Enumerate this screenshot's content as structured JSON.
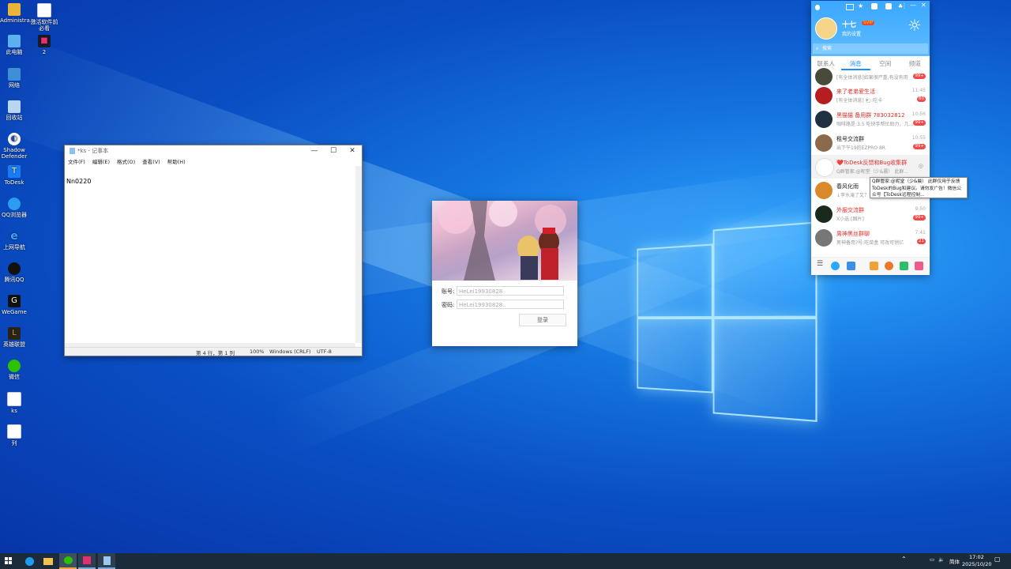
{
  "desktop": {
    "icons": [
      {
        "label": "Administra...",
        "icon": "user-folder-icon"
      },
      {
        "label": "激活软件前必看",
        "icon": "text-file-icon"
      },
      {
        "label": "此电脑",
        "icon": "computer-icon"
      },
      {
        "label": "2",
        "icon": "app-icon"
      },
      {
        "label": "网络",
        "icon": "network-icon"
      },
      {
        "label": "回收站",
        "icon": "recycle-bin-icon"
      },
      {
        "label": "Shadow Defender",
        "icon": "shadow-defender-icon"
      },
      {
        "label": "ToDesk",
        "icon": "todesk-icon"
      },
      {
        "label": "QQ浏览器",
        "icon": "qq-browser-icon"
      },
      {
        "label": "上网导航",
        "icon": "ie-icon"
      },
      {
        "label": "腾讯QQ",
        "icon": "qq-icon"
      },
      {
        "label": "WeGame",
        "icon": "wegame-icon"
      },
      {
        "label": "英雄联盟",
        "icon": "lol-icon"
      },
      {
        "label": "微信",
        "icon": "wechat-icon"
      },
      {
        "label": "ks",
        "icon": "text-file-icon"
      },
      {
        "label": "列",
        "icon": "text-file-icon"
      }
    ]
  },
  "notepad": {
    "title": "*ks - 记事本",
    "menu": [
      "文件(F)",
      "编辑(E)",
      "格式(O)",
      "查看(V)",
      "帮助(H)"
    ],
    "content": "Nn0220",
    "status": {
      "position": "第 4 行，第 1 列",
      "zoom": "100%",
      "line_ending": "Windows (CRLF)",
      "encoding": "UTF-8"
    }
  },
  "login": {
    "account_label": "账号:",
    "account_value": "HeLei19930828",
    "password_label": "密码:",
    "password_value": "HeLei19930828..",
    "login_button": "登录"
  },
  "qq": {
    "nickname": "十七",
    "vip": "SVIP",
    "status": "我的设置",
    "search_placeholder": "搜索",
    "tabs": [
      "联系人",
      "消息",
      "空间",
      "频道"
    ],
    "active_tab": "消息",
    "conversations": [
      {
        "name": "",
        "preview": "[有全体消息]如果很严重,有没有用",
        "time": "",
        "badge": "99+",
        "name_red": false
      },
      {
        "name": "来了老弟爱生活",
        "preview": "[有全体消息] 🐑:吃卡",
        "time": "11:45",
        "badge": "60",
        "name_red": true
      },
      {
        "name": "黑猫猫 备用群 783032812",
        "preview": "咖啡路是:3.5 吃快手帮忙助力，几...",
        "time": "10:56",
        "badge": "99+",
        "name_red": true
      },
      {
        "name": "租号交流群",
        "preview": "出下午19的EZPRO 8R",
        "time": "10:55",
        "badge": "99+",
        "name_red": false
      },
      {
        "name": "❤️ToDesk反馈和Bug收集群",
        "preview": "Q群管家:@昵堂（少&晨） 此群...",
        "time": "",
        "badge": "",
        "name_red": true
      },
      {
        "name": "春风化雨",
        "preview": "↓李水淹了又？",
        "time": "",
        "badge": "",
        "name_red": false
      },
      {
        "name": "外服交流群",
        "preview": "X小选:[图片]",
        "time": "9:50",
        "badge": "99+",
        "name_red": true
      },
      {
        "name": "男神黑丝群聊",
        "preview": "男神备用?号:吃苗盒 可改可悄亿",
        "time": "7:41",
        "badge": "21",
        "name_red": true
      }
    ],
    "tooltip": "Q群管家:@昵堂（少&晨） 此群仅用于反馈ToDesk的Bug和建议。请勿发广告！微信公众号【ToDesk远程控制..."
  },
  "taskbar": {
    "time": "17:02",
    "date": "2025/10/20",
    "ime": "简体"
  }
}
